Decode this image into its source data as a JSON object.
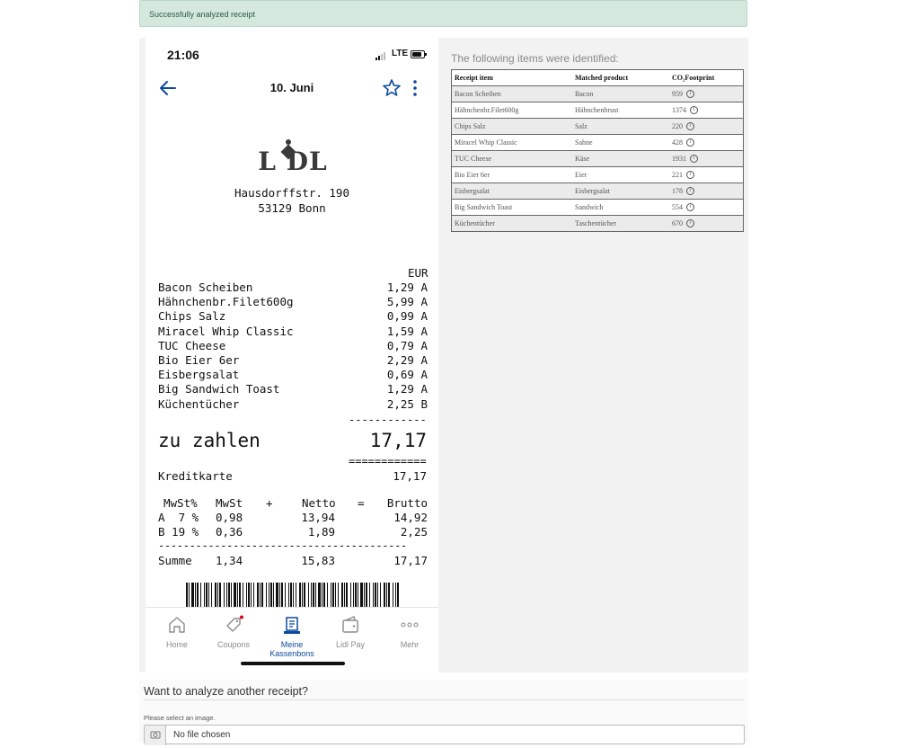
{
  "alert": {
    "text": "Successfully analyzed receipt"
  },
  "phone": {
    "status": {
      "time": "21:06",
      "network": "LTE"
    },
    "header": {
      "title": "10. Juni"
    },
    "receipt": {
      "logo": "LIDL",
      "address_line1": "Hausdorffstr. 190",
      "address_line2": "53129 Bonn",
      "currency": "EUR",
      "items": [
        {
          "name": "Bacon Scheiben",
          "price": "1,29 A"
        },
        {
          "name": "Hähnchenbr.Filet600g",
          "price": "5,99 A"
        },
        {
          "name": "Chips Salz",
          "price": "0,99 A"
        },
        {
          "name": "Miracel Whip Classic",
          "price": "1,59 A"
        },
        {
          "name": "TUC Cheese",
          "price": "0,79 A"
        },
        {
          "name": "Bio Eier 6er",
          "price": "2,29 A"
        },
        {
          "name": "Eisbergsalat",
          "price": "0,69 A"
        },
        {
          "name": "Big Sandwich Toast",
          "price": "1,29 A"
        },
        {
          "name": "Küchentücher",
          "price": "2,25 B"
        }
      ],
      "dash_short": "------------",
      "total_label": "zu zahlen",
      "total_value": "17,17",
      "double_line": "============",
      "payment_label": "Kreditkarte",
      "payment_value": "17,17",
      "tax_header": {
        "c1": "MwSt%",
        "c2": "MwSt",
        "c3": "+",
        "c4": "Netto",
        "c5": "=",
        "c6": "Brutto"
      },
      "tax_rows": [
        {
          "c1": "A  7 %",
          "c2": "0,98",
          "c4": "13,94",
          "c6": "14,92"
        },
        {
          "c1": "B 19 %",
          "c2": "0,36",
          "c4": "1,89",
          "c6": "2,25"
        }
      ],
      "dash_long": "----------------------------------------",
      "sum": {
        "c1": "Summe",
        "c2": "1,34",
        "c4": "15,83",
        "c6": "17,17"
      }
    },
    "tabs": [
      {
        "label": "Home",
        "icon": "home-icon"
      },
      {
        "label": "Coupons",
        "icon": "coupon-icon"
      },
      {
        "label": "Meine Kassenbons",
        "icon": "receipt-icon"
      },
      {
        "label": "Lidl Pay",
        "icon": "wallet-icon"
      },
      {
        "label": "Mehr",
        "icon": "more-icon"
      }
    ]
  },
  "results": {
    "heading": "The following items were identified:",
    "columns": [
      "Receipt item",
      "Matched product",
      "CO₂Footprint"
    ],
    "rows": [
      {
        "item": "Bacon Scheiben",
        "product": "Bacon",
        "co2": "959"
      },
      {
        "item": "Hähnchenbr.Filet600g",
        "product": "Hähnchenbrust",
        "co2": "1374"
      },
      {
        "item": "Chips Salz",
        "product": "Salz",
        "co2": "220"
      },
      {
        "item": "Miracel Whip Classic",
        "product": "Sahne",
        "co2": "428"
      },
      {
        "item": "TUC Cheese",
        "product": "Käse",
        "co2": "1931"
      },
      {
        "item": "Bio Eier 6er",
        "product": "Eier",
        "co2": "221"
      },
      {
        "item": "Eisbergsalat",
        "product": "Eisbergsalat",
        "co2": "178"
      },
      {
        "item": "Big Sandwich Toast",
        "product": "Sandwich",
        "co2": "554"
      },
      {
        "item": "Küchentücher",
        "product": "Taschentücher",
        "co2": "670"
      }
    ],
    "info_glyph": "i"
  },
  "another": {
    "heading": "Want to analyze another receipt?",
    "select_label": "Please select an image.",
    "file_text": "No file chosen"
  },
  "colors": {
    "accent": "#0a4a9e",
    "alert_bg": "#d4e8de",
    "lidl_logo": "#3a3a3a",
    "notify_dot": "#e3001b"
  }
}
